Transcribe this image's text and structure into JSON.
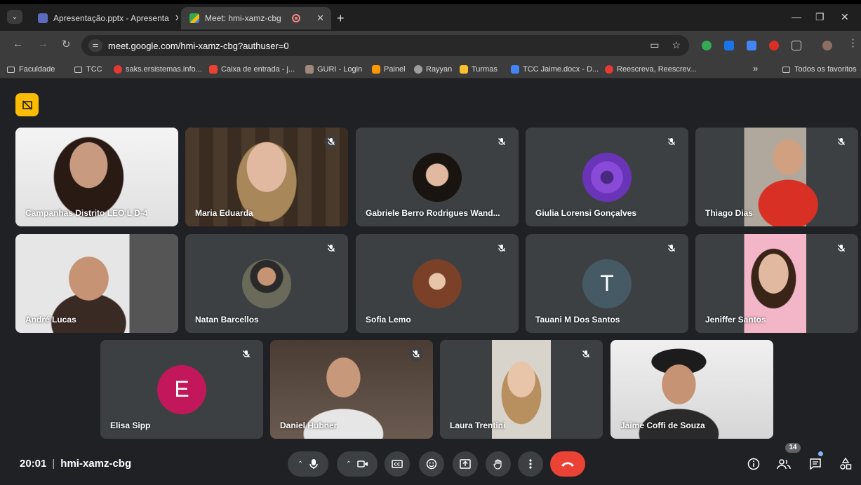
{
  "browser": {
    "tabs": [
      {
        "title": "Apresentação.pptx - Apresenta",
        "active": false
      },
      {
        "title": "Meet: hmi-xamz-cbg",
        "active": true
      }
    ],
    "url": "meet.google.com/hmi-xamz-cbg?authuser=0",
    "bookmarks": [
      {
        "label": "Faculdade",
        "icon": "folder-icon"
      },
      {
        "label": "TCC",
        "icon": "folder-icon"
      },
      {
        "label": "saks.ersistemas.info...",
        "icon": "site-icon"
      },
      {
        "label": "Caixa de entrada - j...",
        "icon": "gmail-icon"
      },
      {
        "label": "GURI - Login",
        "icon": "site-icon"
      },
      {
        "label": "Painel",
        "icon": "site-icon"
      },
      {
        "label": "Rayyan",
        "icon": "site-icon"
      },
      {
        "label": "Turmas",
        "icon": "site-icon"
      },
      {
        "label": "TCC Jaime.docx - D...",
        "icon": "docs-icon"
      },
      {
        "label": "Reescreva, Reescrev...",
        "icon": "site-icon"
      }
    ],
    "bookmarks_overflow": "»",
    "all_bookmarks": "Todos os favoritos"
  },
  "meeting": {
    "time": "20:01",
    "code": "hmi-xamz-cbg",
    "participant_count": "14",
    "participants": [
      {
        "name": "Campanhas Distrito LEO L D-4",
        "type": "video",
        "muted": false
      },
      {
        "name": "Maria Eduarda",
        "type": "video",
        "muted": true
      },
      {
        "name": "Gabriele Berro Rodrigues Wand...",
        "type": "photo",
        "muted": true
      },
      {
        "name": "Giulia Lorensi Gonçalves",
        "type": "photo",
        "muted": true
      },
      {
        "name": "Thiago Dias",
        "type": "video",
        "muted": true
      },
      {
        "name": "André Lucas",
        "type": "video",
        "muted": false
      },
      {
        "name": "Natan Barcellos",
        "type": "photo",
        "muted": true
      },
      {
        "name": "Sofia Lemo",
        "type": "photo",
        "muted": true
      },
      {
        "name": "Tauani M Dos Santos",
        "type": "letter",
        "letter": "T",
        "muted": true
      },
      {
        "name": "Jeniffer Santos",
        "type": "video",
        "muted": true
      },
      {
        "name": "Elisa Sipp",
        "type": "letter",
        "letter": "E",
        "muted": true
      },
      {
        "name": "Daniel Hubner",
        "type": "video",
        "muted": true
      },
      {
        "name": "Laura Trentini",
        "type": "video",
        "muted": true
      },
      {
        "name": "Jaime Coffi de Souza",
        "type": "video",
        "muted": false
      }
    ]
  },
  "colors": {
    "accent_yellow": "#fbbc04",
    "hangup_red": "#ea4335",
    "tile_bg": "#3c4043",
    "avatar_T": "#455a64",
    "avatar_E": "#c2185b"
  }
}
